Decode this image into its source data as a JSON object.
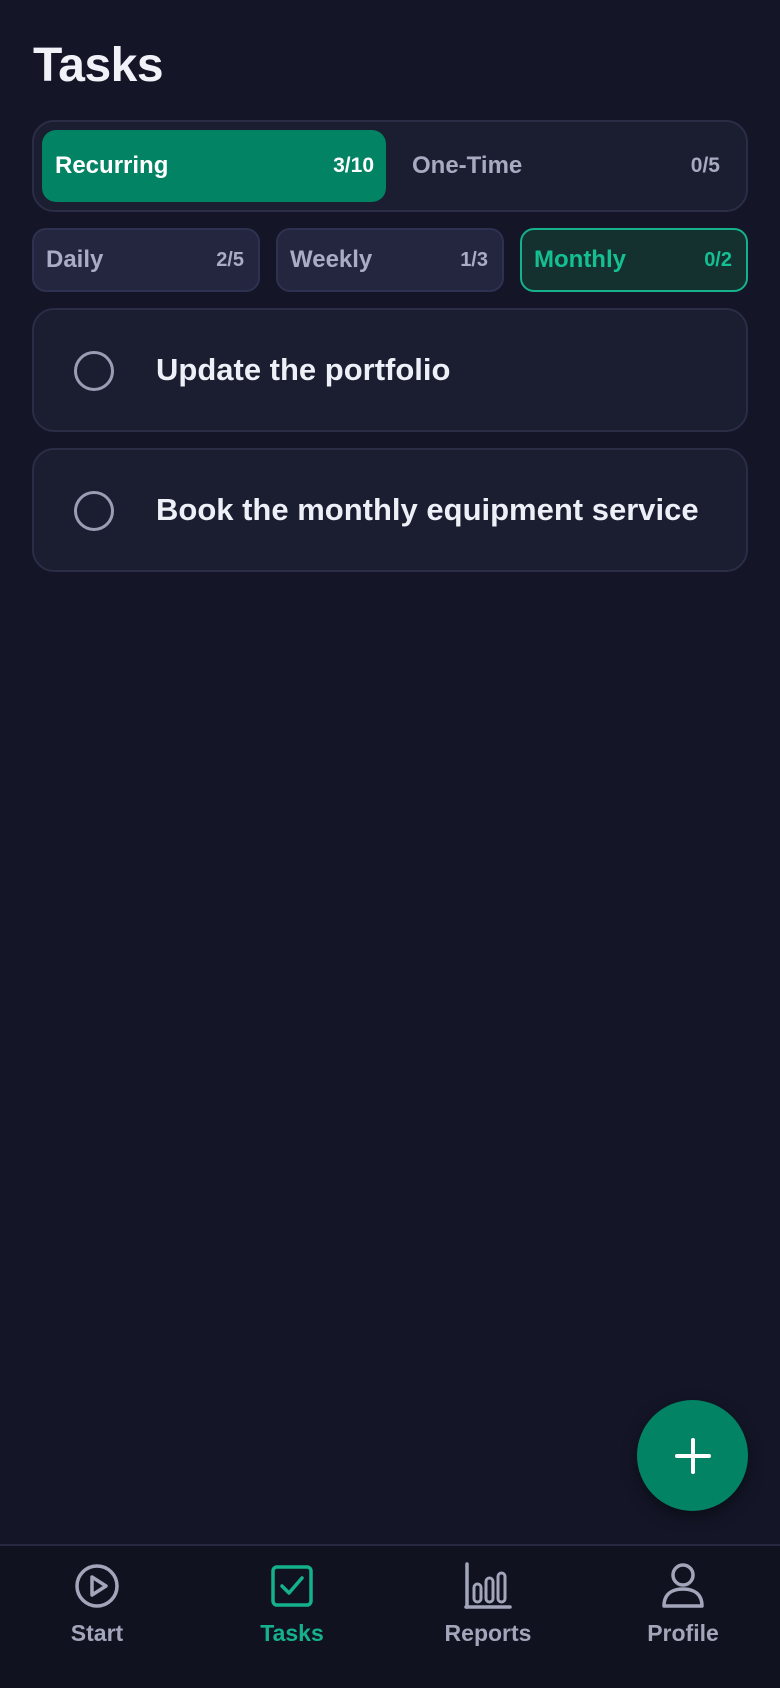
{
  "header": {
    "title": "Tasks"
  },
  "type_tabs": [
    {
      "label": "Recurring",
      "count": "3/10",
      "active": true
    },
    {
      "label": "One-Time",
      "count": "0/5",
      "active": false
    }
  ],
  "frequency_chips": [
    {
      "label": "Daily",
      "count": "2/5",
      "active": false
    },
    {
      "label": "Weekly",
      "count": "1/3",
      "active": false
    },
    {
      "label": "Monthly",
      "count": "0/2",
      "active": true
    }
  ],
  "tasks": [
    {
      "title": "Update the portfolio",
      "completed": false
    },
    {
      "title": "Book the monthly equipment service",
      "completed": false
    }
  ],
  "fab": {
    "icon": "plus-icon"
  },
  "bottom_nav": [
    {
      "label": "Start",
      "icon": "play-circle-icon",
      "active": false
    },
    {
      "label": "Tasks",
      "icon": "checkbox-icon",
      "active": true
    },
    {
      "label": "Reports",
      "icon": "bar-chart-icon",
      "active": false
    },
    {
      "label": "Profile",
      "icon": "person-icon",
      "active": false
    }
  ],
  "colors": {
    "background": "#141628",
    "card": "#1b1d31",
    "accent": "#018364",
    "accent_text": "#14b28c",
    "muted_text": "#a3a6bb"
  }
}
